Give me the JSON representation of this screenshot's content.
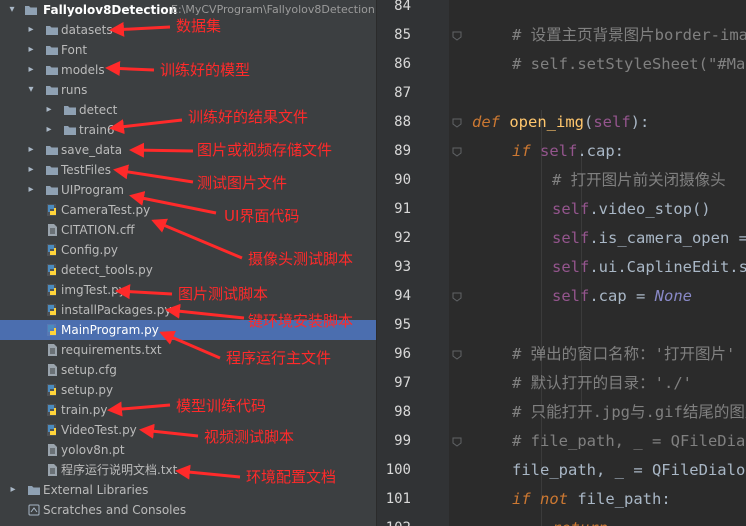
{
  "project_tree": {
    "project_name": "Fallyolov8Detection",
    "project_path": "E:\\MyCVProgram\\Fallyolov8Detection",
    "items": [
      {
        "label": "datasets",
        "type": "folder"
      },
      {
        "label": "Font",
        "type": "folder"
      },
      {
        "label": "models",
        "type": "folder"
      },
      {
        "label": "runs",
        "type": "folder"
      },
      {
        "label": "detect",
        "type": "folder"
      },
      {
        "label": "train6",
        "type": "folder"
      },
      {
        "label": "save_data",
        "type": "folder"
      },
      {
        "label": "TestFiles",
        "type": "folder"
      },
      {
        "label": "UIProgram",
        "type": "folder"
      },
      {
        "label": "CameraTest.py",
        "type": "python"
      },
      {
        "label": "CITATION.cff",
        "type": "text"
      },
      {
        "label": "Config.py",
        "type": "python"
      },
      {
        "label": "detect_tools.py",
        "type": "python"
      },
      {
        "label": "imgTest.py",
        "type": "python"
      },
      {
        "label": "installPackages.py",
        "type": "python"
      },
      {
        "label": "MainProgram.py",
        "type": "python",
        "selected": true
      },
      {
        "label": "requirements.txt",
        "type": "text"
      },
      {
        "label": "setup.cfg",
        "type": "text"
      },
      {
        "label": "setup.py",
        "type": "python"
      },
      {
        "label": "train.py",
        "type": "python"
      },
      {
        "label": "VideoTest.py",
        "type": "python"
      },
      {
        "label": "yolov8n.pt",
        "type": "text"
      },
      {
        "label": "程序运行说明文档.txt",
        "type": "text"
      },
      {
        "label": "External Libraries",
        "type": "library"
      },
      {
        "label": "Scratches and Consoles",
        "type": "scratches"
      }
    ]
  },
  "annotations": [
    {
      "text": "数据集"
    },
    {
      "text": "训练好的模型"
    },
    {
      "text": "训练好的结果文件"
    },
    {
      "text": "图片或视频存储文件"
    },
    {
      "text": "测试图片文件"
    },
    {
      "text": "UI界面代码"
    },
    {
      "text": "摄像头测试脚本"
    },
    {
      "text": "图片测试脚本"
    },
    {
      "text": "键环境安装脚本"
    },
    {
      "text": "程序运行主文件"
    },
    {
      "text": "模型训练代码"
    },
    {
      "text": "视频测试脚本"
    },
    {
      "text": "环境配置文档"
    }
  ],
  "editor": {
    "line_numbers": [
      "84",
      "85",
      "86",
      "87",
      "88",
      "89",
      "90",
      "91",
      "92",
      "93",
      "94",
      "95",
      "96",
      "97",
      "98",
      "99",
      "100",
      "101",
      "102"
    ],
    "code": {
      "l85": "# 设置主页背景图片border-image",
      "l86": "# self.setStyleSheet(\"#MainWindow{border-image:url(:/icons/ui_imgs/bg.jpg)}\")",
      "l88_def": "def",
      "l88_name": "open_img",
      "l88_open": "(",
      "l88_self": "self",
      "l88_close": "):",
      "l89_if": "if",
      "l89_self": "self",
      "l89_rest": ".cap:",
      "l90": "# 打开图片前关闭摄像头",
      "l91_self": "self",
      "l91_rest": ".video_stop()",
      "l92_self": "self",
      "l92_rest": ".is_camera_open = False",
      "l93_self": "self",
      "l93_rest": ".ui.CaplineEdit.setText('摄像头未开启')",
      "l94_self": "self",
      "l94_rest": ".cap = ",
      "l94_none": "None",
      "l96": "# 弹出的窗口名称：'打开图片'",
      "l97": "# 默认打开的目录：'./'",
      "l98": "# 只能打开.jpg与.gif结尾的图片文件",
      "l99": "# file_path, _ = QFileDialog.getOpenFileName(self.centralwidget, '打开图片', './')",
      "l100": "file_path, _ = QFileDialog.getOpenFileName(None, '打开图片', './')",
      "l101_if": "if",
      "l101_not": "not",
      "l101_rest": " file_path:",
      "l102_kw": "return"
    }
  },
  "colors": {
    "annotation": "#ff2a2a",
    "selection": "#4b6eaf",
    "folder": "#8fa1b3",
    "python": "#4b8bbe",
    "pythonYellow": "#ffd43b"
  }
}
